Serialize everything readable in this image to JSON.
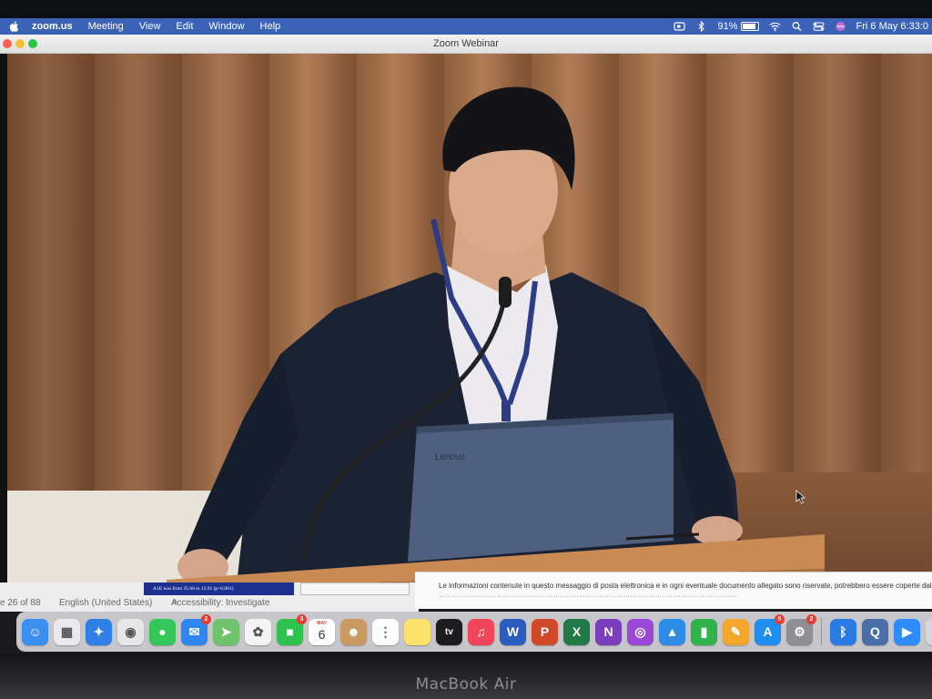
{
  "menubar": {
    "app_name": "zoom.us",
    "menus": [
      "Meeting",
      "View",
      "Edit",
      "Window",
      "Help"
    ],
    "battery_percent": "91%",
    "battery_level": 0.91,
    "clock": "Fri 6 May  6:33:0"
  },
  "window": {
    "title": "Zoom Webinar"
  },
  "background_windows": {
    "slide_counter": "e 26 of 88",
    "language": "English (United States)",
    "accessibility": "Accessibility: Investigate",
    "slide_snippet": "A1E was from 35.66 to 13.91 (p<0.001)",
    "email_line_1": "Le informazioni contenute in questo messaggio di posta elettronica e in ogni eventuale documento allegato sono riservate, potrebbero essere coperte dal segreto profession"
  },
  "video": {
    "laptop_brand": "Lenovo"
  },
  "dock": {
    "apps": [
      {
        "name": "finder",
        "color": "#3b8ff0",
        "glyph": "☺",
        "badge": ""
      },
      {
        "name": "launchpad",
        "color": "#e9e9ef",
        "glyph": "▦",
        "badge": ""
      },
      {
        "name": "safari",
        "color": "#2f7fe6",
        "glyph": "✦",
        "badge": ""
      },
      {
        "name": "chrome",
        "color": "#e7e7e7",
        "glyph": "◉",
        "badge": ""
      },
      {
        "name": "messages",
        "color": "#34c759",
        "glyph": "●",
        "badge": ""
      },
      {
        "name": "mail",
        "color": "#2d86f2",
        "glyph": "✉",
        "badge": "2"
      },
      {
        "name": "maps",
        "color": "#6fc36b",
        "glyph": "➤",
        "badge": ""
      },
      {
        "name": "photos",
        "color": "#f4f4f4",
        "glyph": "✿",
        "badge": ""
      },
      {
        "name": "facetime",
        "color": "#30c24f",
        "glyph": "■",
        "badge": "3"
      },
      {
        "name": "calendar",
        "color": "#ffffff",
        "glyph": "",
        "badge": ""
      },
      {
        "name": "contacts",
        "color": "#c99b63",
        "glyph": "☻",
        "badge": ""
      },
      {
        "name": "reminders",
        "color": "#ffffff",
        "glyph": "⋮",
        "badge": ""
      },
      {
        "name": "notes",
        "color": "#fbe26b",
        "glyph": "",
        "badge": ""
      },
      {
        "name": "tv",
        "color": "#1c1c1e",
        "glyph": "tv",
        "badge": ""
      },
      {
        "name": "music",
        "color": "#f2455a",
        "glyph": "♫",
        "badge": ""
      },
      {
        "name": "word",
        "color": "#2b5cbf",
        "glyph": "W",
        "badge": ""
      },
      {
        "name": "powerpoint",
        "color": "#d2492a",
        "glyph": "P",
        "badge": ""
      },
      {
        "name": "excel",
        "color": "#1f7a45",
        "glyph": "X",
        "badge": ""
      },
      {
        "name": "onenote",
        "color": "#7b3dbc",
        "glyph": "N",
        "badge": ""
      },
      {
        "name": "podcasts",
        "color": "#9b48d8",
        "glyph": "◎",
        "badge": ""
      },
      {
        "name": "keynote",
        "color": "#2c8ce8",
        "glyph": "▲",
        "badge": ""
      },
      {
        "name": "numbers",
        "color": "#2fb34a",
        "glyph": "▮",
        "badge": ""
      },
      {
        "name": "pages",
        "color": "#f6a62d",
        "glyph": "✎",
        "badge": ""
      },
      {
        "name": "app-store",
        "color": "#1e8ff0",
        "glyph": "A",
        "badge": "5"
      },
      {
        "name": "system-preferences",
        "color": "#8e8e93",
        "glyph": "⚙",
        "badge": "2"
      },
      {
        "name": "bluetooth",
        "color": "#2b7be5",
        "glyph": "ᛒ",
        "badge": ""
      },
      {
        "name": "quicktime",
        "color": "#4a6ea8",
        "glyph": "Q",
        "badge": ""
      },
      {
        "name": "zoom",
        "color": "#2d8cff",
        "glyph": "▶",
        "badge": ""
      },
      {
        "name": "folder",
        "color": "#d6d6db",
        "glyph": "",
        "badge": ""
      }
    ],
    "calendar_month": "MAY",
    "calendar_day": "6"
  },
  "frame": {
    "label": "MacBook Air"
  }
}
